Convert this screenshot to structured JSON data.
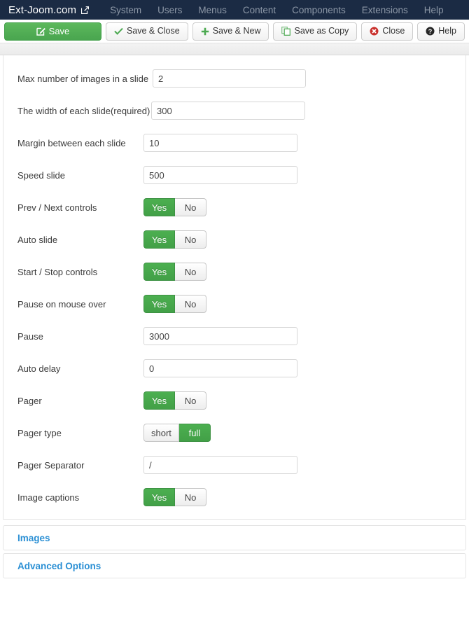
{
  "navbar": {
    "brand": "Ext-Joom.com",
    "brand_icon": "external-link-icon",
    "links": [
      "System",
      "Users",
      "Menus",
      "Content",
      "Components",
      "Extensions",
      "Help"
    ]
  },
  "toolbar": {
    "buttons": [
      {
        "label": "Save",
        "icon": "pencil-square-icon"
      },
      {
        "label": "Save & Close",
        "icon": "check-icon"
      },
      {
        "label": "Save & New",
        "icon": "plus-icon"
      },
      {
        "label": "Save as Copy",
        "icon": "copy-icon"
      },
      {
        "label": "Close",
        "icon": "cancel-circle-icon"
      },
      {
        "label": "Help",
        "icon": "question-circle-icon"
      }
    ]
  },
  "form": {
    "fields": [
      {
        "label": "Max number of images in a slide",
        "type": "text",
        "value": "2"
      },
      {
        "label": "The width of each slide(required)",
        "type": "text",
        "value": "300"
      },
      {
        "label": "Margin between each slide",
        "type": "text",
        "value": "10"
      },
      {
        "label": "Speed slide",
        "type": "text",
        "value": "500"
      },
      {
        "label": "Prev / Next controls",
        "type": "toggle",
        "options": [
          "Yes",
          "No"
        ],
        "selected": "Yes"
      },
      {
        "label": "Auto slide",
        "type": "toggle",
        "options": [
          "Yes",
          "No"
        ],
        "selected": "Yes"
      },
      {
        "label": "Start / Stop controls",
        "type": "toggle",
        "options": [
          "Yes",
          "No"
        ],
        "selected": "Yes"
      },
      {
        "label": "Pause on mouse over",
        "type": "toggle",
        "options": [
          "Yes",
          "No"
        ],
        "selected": "Yes"
      },
      {
        "label": "Pause",
        "type": "text",
        "value": "3000"
      },
      {
        "label": "Auto delay",
        "type": "text",
        "value": "0"
      },
      {
        "label": "Pager",
        "type": "toggle",
        "options": [
          "Yes",
          "No"
        ],
        "selected": "Yes"
      },
      {
        "label": "Pager type",
        "type": "toggle",
        "options": [
          "short",
          "full"
        ],
        "selected": "full"
      },
      {
        "label": "Pager Separator",
        "type": "text",
        "value": "/"
      },
      {
        "label": "Image captions",
        "type": "toggle",
        "options": [
          "Yes",
          "No"
        ],
        "selected": "Yes"
      }
    ]
  },
  "accordion": {
    "items": [
      "Images",
      "Advanced Options"
    ]
  },
  "colors": {
    "navbar_bg": "#1b2b44",
    "nav_link": "#8c97a6",
    "save_green": "#4fb055",
    "toggle_green": "#46a54c",
    "accordion_link": "#2a8fd4"
  }
}
